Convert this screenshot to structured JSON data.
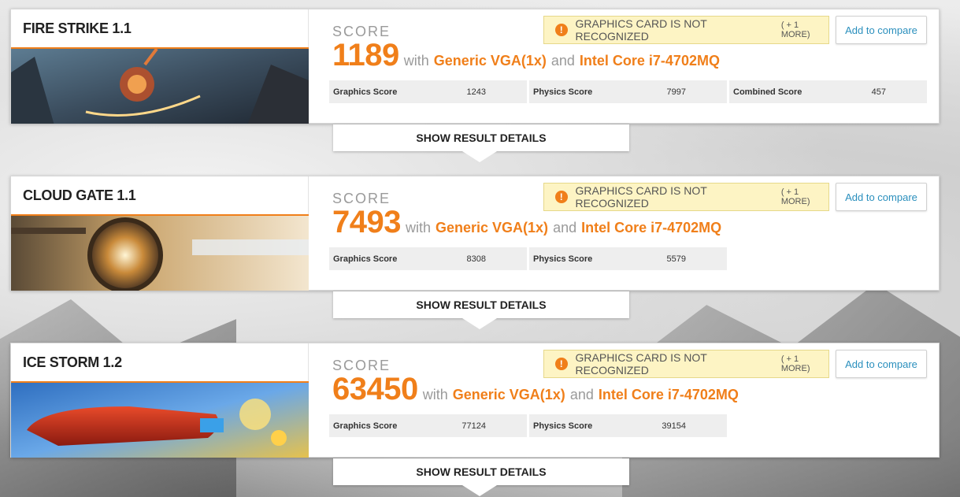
{
  "colors": {
    "accent": "#f07f1a",
    "link": "#2a8fbd",
    "warning_bg": "#fdf4c4"
  },
  "common": {
    "score_label": "SCORE",
    "with": "with",
    "and": "and",
    "gpu": "Generic VGA(1x)",
    "cpu": "Intel Core i7-4702MQ",
    "warning_icon": "exclamation-icon",
    "warning_glyph": "!",
    "warning_text": "GRAPHICS CARD IS NOT RECOGNIZED",
    "warning_more": "( + 1 MORE)",
    "compare_label": "Add to compare",
    "details_label": "SHOW RESULT DETAILS"
  },
  "results": [
    {
      "title": "FIRE STRIKE 1.1",
      "score": "1189",
      "subscores": [
        {
          "label": "Graphics Score",
          "value": "1243"
        },
        {
          "label": "Physics Score",
          "value": "7997"
        },
        {
          "label": "Combined Score",
          "value": "457"
        }
      ]
    },
    {
      "title": "CLOUD GATE 1.1",
      "score": "7493",
      "subscores": [
        {
          "label": "Graphics Score",
          "value": "8308"
        },
        {
          "label": "Physics Score",
          "value": "5579"
        }
      ]
    },
    {
      "title": "ICE STORM 1.2",
      "score": "63450",
      "subscores": [
        {
          "label": "Graphics Score",
          "value": "77124"
        },
        {
          "label": "Physics Score",
          "value": "39154"
        }
      ]
    }
  ]
}
